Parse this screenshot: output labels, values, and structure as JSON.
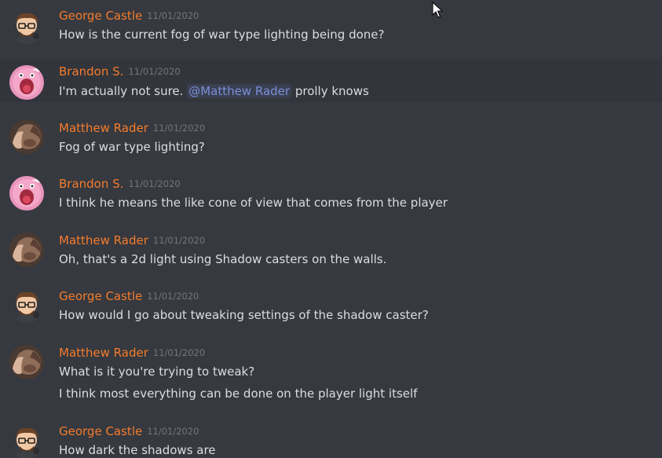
{
  "colors": {
    "background": "#36393f",
    "author": "#f47b2c",
    "timestamp": "#72767d",
    "text": "#dcddde",
    "mention": "#7a8fd8"
  },
  "messages": [
    {
      "author": "George Castle",
      "timestamp": "11/01/2020",
      "avatar": "george-avatar",
      "lines": [
        "How is the current fog of war type lighting being done?"
      ]
    },
    {
      "author": "Brandon S.",
      "timestamp": "11/01/2020",
      "avatar": "brandon-avatar",
      "lines": [
        {
          "before": "I'm actually not sure. ",
          "mention": "@Matthew Rader",
          "after": " prolly knows"
        }
      ]
    },
    {
      "author": "Matthew Rader",
      "timestamp": "11/01/2020",
      "avatar": "matthew-avatar",
      "lines": [
        "Fog of war type lighting?"
      ]
    },
    {
      "author": "Brandon S.",
      "timestamp": "11/01/2020",
      "avatar": "brandon-avatar",
      "lines": [
        "I think he means the like cone of view that comes from the player"
      ]
    },
    {
      "author": "Matthew Rader",
      "timestamp": "11/01/2020",
      "avatar": "matthew-avatar",
      "lines": [
        "Oh, that's a 2d light using Shadow casters on the walls."
      ]
    },
    {
      "author": "George Castle",
      "timestamp": "11/01/2020",
      "avatar": "george-avatar",
      "lines": [
        "How would I go about tweaking settings of the shadow caster?"
      ]
    },
    {
      "author": "Matthew Rader",
      "timestamp": "11/01/2020",
      "avatar": "matthew-avatar",
      "lines": [
        "What is it you're trying to tweak?",
        "I think most everything can be done on the player light itself"
      ]
    },
    {
      "author": "George Castle",
      "timestamp": "11/01/2020",
      "avatar": "george-avatar",
      "lines": [
        "How dark the shadows are"
      ]
    }
  ]
}
